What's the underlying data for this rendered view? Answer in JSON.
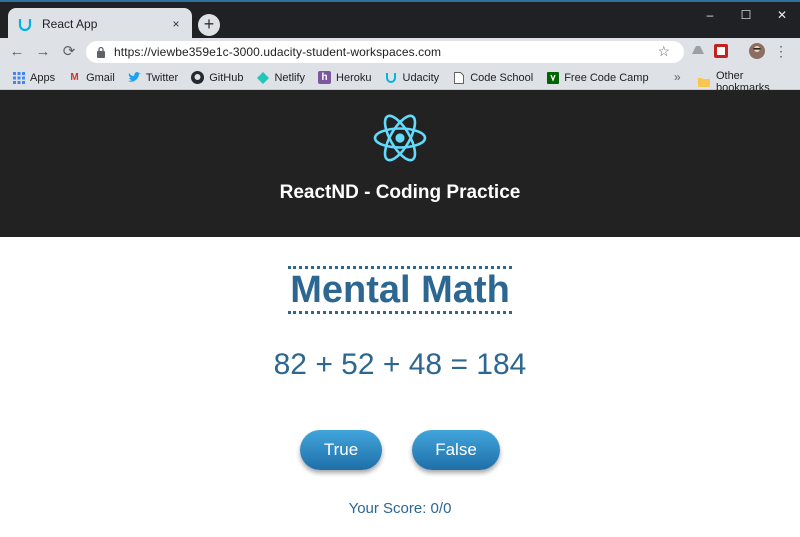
{
  "browser": {
    "tab_title": "React App",
    "tab_close_glyph": "×",
    "new_tab_glyph": "+",
    "url": "https://viewbe359e1c-3000.udacity-student-workspaces.com",
    "window_controls": {
      "minimize": "–",
      "maximize": "☐",
      "close": "✕"
    },
    "nav": {
      "back": "←",
      "forward": "→",
      "reload": "⟳"
    },
    "star_glyph": "☆",
    "menu_glyph": "⋮"
  },
  "bookmarks": {
    "items": [
      {
        "label": "Apps",
        "icon": "apps-grid-icon"
      },
      {
        "label": "Gmail",
        "icon": "gmail-icon"
      },
      {
        "label": "Twitter",
        "icon": "twitter-icon"
      },
      {
        "label": "GitHub",
        "icon": "github-icon"
      },
      {
        "label": "Netlify",
        "icon": "netlify-icon"
      },
      {
        "label": "Heroku",
        "icon": "heroku-icon"
      },
      {
        "label": "Udacity",
        "icon": "udacity-icon"
      },
      {
        "label": "Code School",
        "icon": "document-icon"
      },
      {
        "label": "Free Code Camp",
        "icon": "freecodecamp-icon"
      }
    ],
    "more_glyph": "»",
    "other": "Other bookmarks"
  },
  "app": {
    "title": "ReactND - Coding Practice",
    "game_title": "Mental Math",
    "equation": "82 + 52 + 48 = 184",
    "true_label": "True",
    "false_label": "False",
    "score": "Your Score: 0/0"
  },
  "colors": {
    "header_bg": "#222222",
    "react_blue": "#61dafb",
    "text_blue": "#2c6791",
    "button_gradient_top": "#42a5dc",
    "button_gradient_bottom": "#1f6fa8"
  }
}
